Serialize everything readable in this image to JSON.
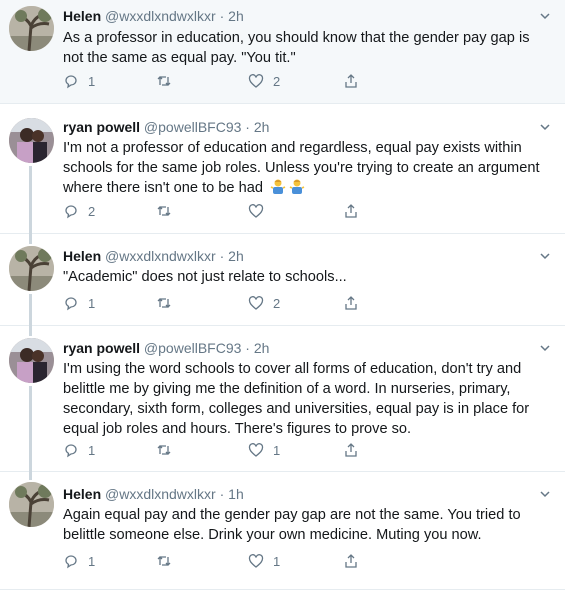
{
  "tweets": [
    {
      "name": "Helen",
      "handle": "@wxxdlxndwxlkxr",
      "time": "2h",
      "text": "As a professor in education, you should know that the gender pay gap is not the same as equal pay. \"You tit.\"",
      "replies": "1",
      "retweets": "",
      "likes": "2"
    },
    {
      "name": "ryan powell",
      "handle": "@powellBFC93",
      "time": "2h",
      "text": "I'm not a professor of education and regardless, equal pay exists within schools for the same job roles. Unless you're trying to create an argument where there isn't one to be had",
      "replies": "2",
      "retweets": "",
      "likes": ""
    },
    {
      "name": "Helen",
      "handle": "@wxxdlxndwxlkxr",
      "time": "2h",
      "text": "\"Academic\" does not just relate to schools...",
      "replies": "1",
      "retweets": "",
      "likes": "2"
    },
    {
      "name": "ryan powell",
      "handle": "@powellBFC93",
      "time": "2h",
      "text": "I'm using the word schools to cover all forms of education, don't try and belittle me by giving me the definition of a word. In nurseries, primary, secondary, sixth form, colleges and universities, equal pay is in place for equal job roles and hours. There's figures to prove so.",
      "replies": "1",
      "retweets": "",
      "likes": "1"
    },
    {
      "name": "Helen",
      "handle": "@wxxdlxndwxlkxr",
      "time": "1h",
      "text": "Again equal pay and the gender pay gap are not the same. You tried to belittle someone else. Drink your own medicine. Muting you now.",
      "replies": "1",
      "retweets": "",
      "likes": "1"
    }
  ],
  "separator": "·",
  "icons": {
    "reply": "reply-icon",
    "retweet": "retweet-icon",
    "like": "heart-icon",
    "share": "share-icon",
    "caret": "chevron-down-icon",
    "emoji": "person-shrugging-emoji"
  },
  "colors": {
    "icon_grey": "#657786",
    "thread_line": "#ccd6dd",
    "highlight_bg": "#f5f8fa"
  }
}
